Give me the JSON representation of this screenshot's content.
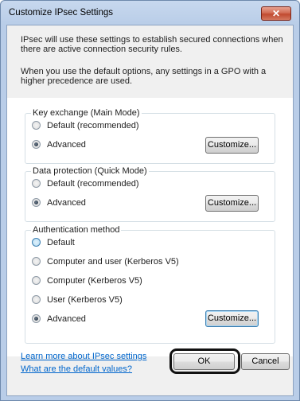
{
  "window": {
    "title": "Customize IPsec Settings",
    "close_glyph": "✕"
  },
  "intro": {
    "line1": "IPsec will use these settings to establish secured connections when there are active connection security rules.",
    "line2": "When you use the default options, any settings in a GPO with a higher precedence are used."
  },
  "key_exchange": {
    "legend": "Key exchange (Main Mode)",
    "options": [
      {
        "label": "Default (recommended)",
        "checked": false
      },
      {
        "label": "Advanced",
        "checked": true
      }
    ],
    "customize_label": "Customize..."
  },
  "data_protection": {
    "legend": "Data protection (Quick Mode)",
    "options": [
      {
        "label": "Default (recommended)",
        "checked": false
      },
      {
        "label": "Advanced",
        "checked": true
      }
    ],
    "customize_label": "Customize..."
  },
  "authentication": {
    "legend": "Authentication method",
    "options": [
      {
        "label": "Default",
        "checked": false
      },
      {
        "label": "Computer and user (Kerberos V5)",
        "checked": false
      },
      {
        "label": "Computer (Kerberos V5)",
        "checked": false
      },
      {
        "label": "User (Kerberos V5)",
        "checked": false
      },
      {
        "label": "Advanced",
        "checked": true
      }
    ],
    "customize_label": "Customize..."
  },
  "links": {
    "learn_more": "Learn more about IPsec settings",
    "defaults": "What are the default values?"
  },
  "footer": {
    "ok_label": "OK",
    "cancel_label": "Cancel"
  },
  "colors": {
    "link": "#0066cc",
    "highlight_ring": "#111111",
    "title_bar": "#b9cde8"
  }
}
